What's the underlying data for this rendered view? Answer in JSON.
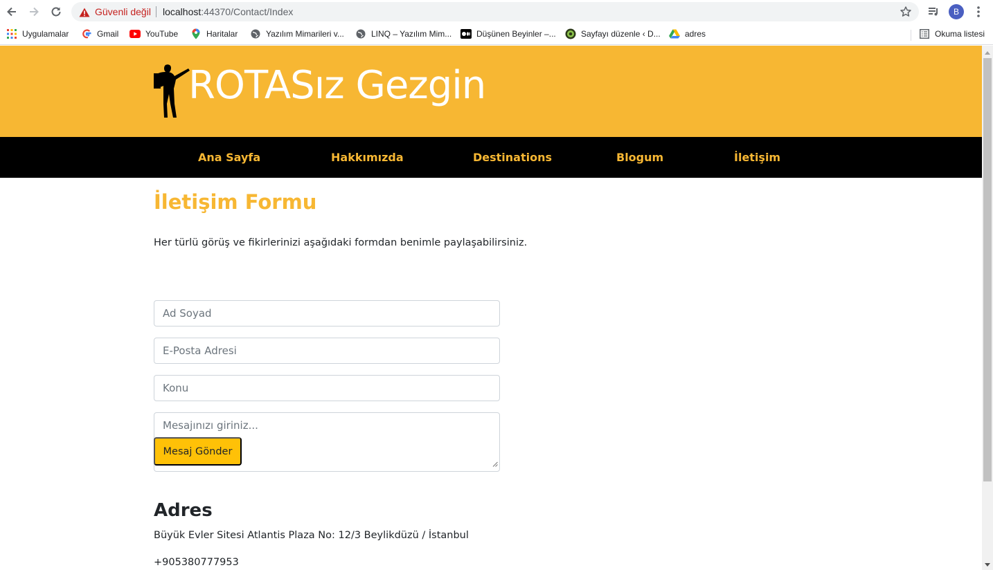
{
  "browser": {
    "security_text": "Güvenli değil",
    "url_host": "localhost",
    "url_rest": ":44370/Contact/Index",
    "avatar_letter": "B",
    "bookmarks": [
      {
        "label": "Uygulamalar",
        "icon": "apps-grid-icon"
      },
      {
        "label": "Gmail",
        "icon": "google-icon"
      },
      {
        "label": "YouTube",
        "icon": "youtube-icon"
      },
      {
        "label": "Haritalar",
        "icon": "maps-pin-icon"
      },
      {
        "label": "Yazılım Mimarileri v...",
        "icon": "globe-icon"
      },
      {
        "label": "LINQ – Yazılım Mim...",
        "icon": "globe-icon"
      },
      {
        "label": "Düşünen Beyinler –...",
        "icon": "medium-icon"
      },
      {
        "label": "Sayfayı düzenle ‹ D...",
        "icon": "site-icon"
      },
      {
        "label": "adres",
        "icon": "drive-icon"
      }
    ],
    "reading_list": "Okuma listesi"
  },
  "site": {
    "logo_text": "ROTASız Gezgin",
    "nav": [
      "Ana Sayfa",
      "Hakkımızda",
      "Destinations",
      "Blogum",
      "İletişim"
    ]
  },
  "contact": {
    "title": "İletişim Formu",
    "intro": "Her türlü görüş ve fikirlerinizi aşağıdaki formdan benimle paylaşabilirsiniz.",
    "name_placeholder": "Ad Soyad",
    "email_placeholder": "E-Posta Adresi",
    "subject_placeholder": "Konu",
    "message_placeholder": "Mesajınızı giriniz...",
    "send_label": "Mesaj Gönder",
    "address_title": "Adres",
    "address": "Büyük Evler Sitesi Atlantis Plaza No: 12/3 Beylikdüzü / İstanbul",
    "phone": "+905380777953"
  },
  "colors": {
    "brand_yellow": "#f7b733",
    "nav_bg": "#000000",
    "button_yellow": "#ffc107"
  }
}
